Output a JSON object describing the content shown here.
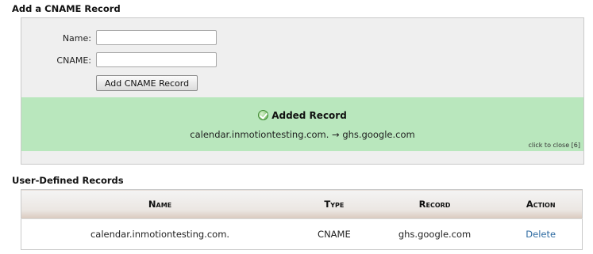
{
  "add_section": {
    "title": "Add a CNAME Record",
    "name_label": "Name:",
    "name_value": "",
    "cname_label": "CNAME:",
    "cname_value": "",
    "submit_label": "Add CNAME Record"
  },
  "success": {
    "heading": "Added Record",
    "detail": "calendar.inmotiontesting.com. → ghs.google.com",
    "close_text": "click to close [6]",
    "icon": "check-circle-icon",
    "background": "#b9e7bd"
  },
  "records_section": {
    "title": "User-Defined Records",
    "columns": [
      "Name",
      "Type",
      "Record",
      "Action"
    ],
    "rows": [
      {
        "name": "calendar.inmotiontesting.com.",
        "type": "CNAME",
        "record": "ghs.google.com",
        "action": "Delete"
      }
    ]
  },
  "colors": {
    "link": "#2d6aa1",
    "panel": "#efefef"
  }
}
